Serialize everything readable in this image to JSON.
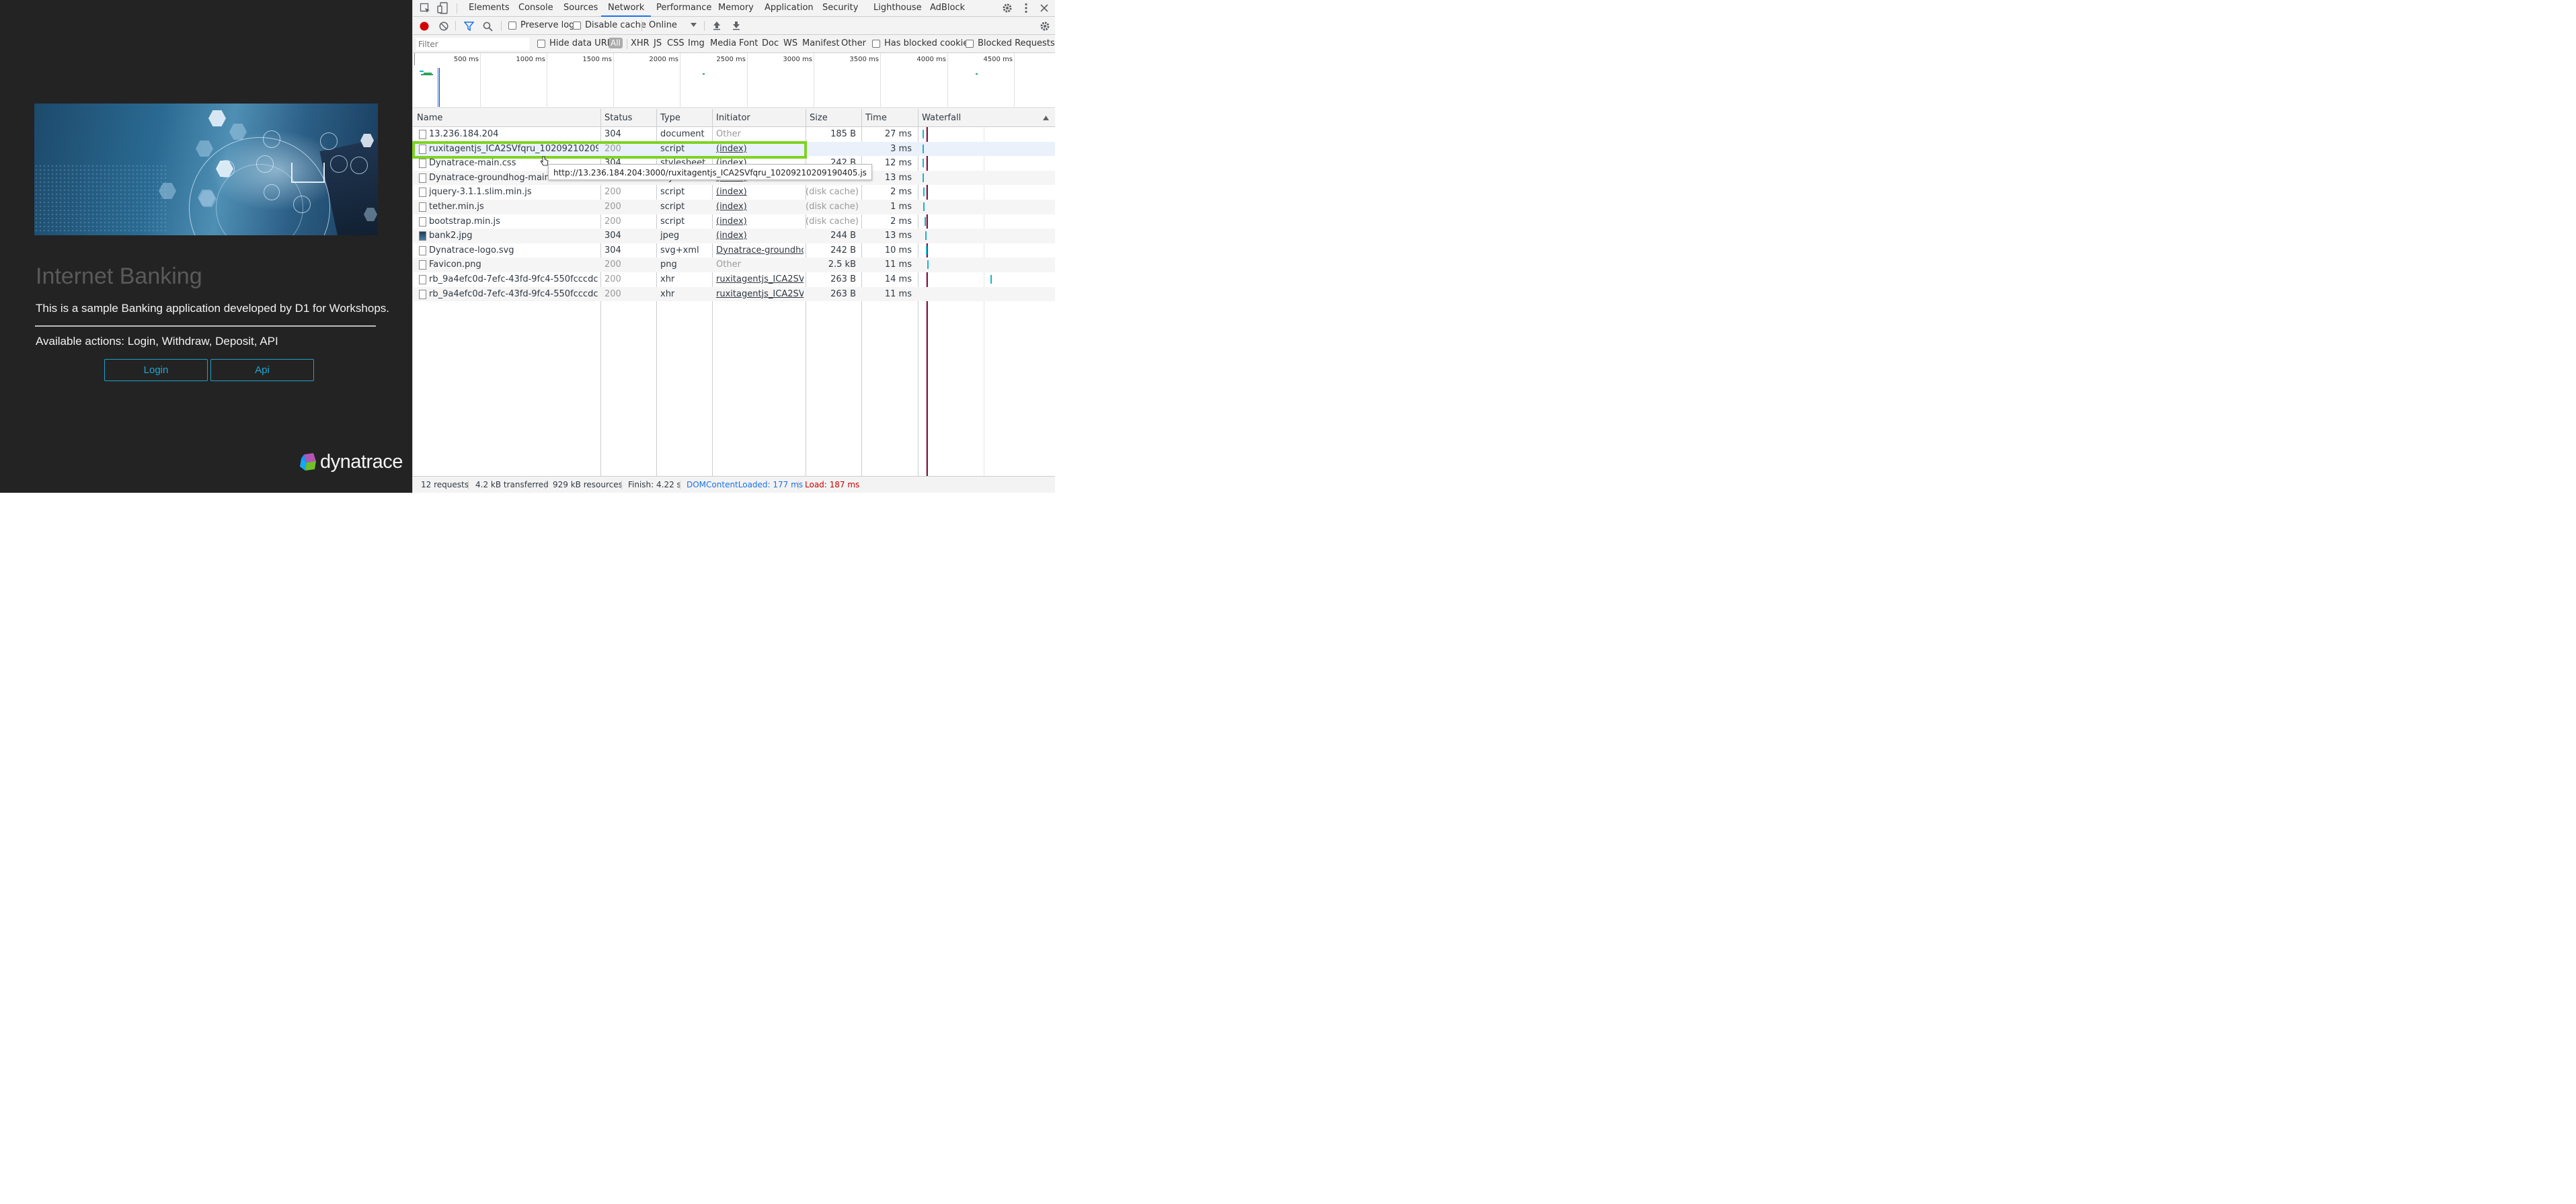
{
  "page": {
    "title": "Internet Banking",
    "description": "This is a sample Banking application developed by D1 for Workshops.",
    "actions": "Available actions: Login, Withdraw, Deposit, API",
    "buttons": {
      "login": "Login",
      "api": "Api"
    },
    "logo_text": "dynatrace"
  },
  "devtools": {
    "tabs": [
      "Elements",
      "Console",
      "Sources",
      "Network",
      "Performance",
      "Memory",
      "Application",
      "Security",
      "Lighthouse",
      "AdBlock"
    ],
    "selected_tab": "Network",
    "toolbar": {
      "preserve_log": "Preserve log",
      "disable_cache": "Disable cache",
      "throttle": "Online"
    },
    "filter": {
      "placeholder": "Filter",
      "hide_data_urls": "Hide data URLs",
      "types": [
        "All",
        "XHR",
        "JS",
        "CSS",
        "Img",
        "Media",
        "Font",
        "Doc",
        "WS",
        "Manifest",
        "Other"
      ],
      "has_blocked_cookies": "Has blocked cookies",
      "blocked_requests": "Blocked Requests"
    },
    "overview_ticks": [
      "500 ms",
      "1000 ms",
      "1500 ms",
      "2000 ms",
      "2500 ms",
      "3000 ms",
      "3500 ms",
      "4000 ms",
      "4500 ms"
    ],
    "columns": {
      "name": "Name",
      "status": "Status",
      "type": "Type",
      "initiator": "Initiator",
      "size": "Size",
      "time": "Time",
      "waterfall": "Waterfall"
    },
    "requests": [
      {
        "name": "13.236.184.204",
        "status": "304",
        "type": "document",
        "initiator": "Other",
        "size": "185 B",
        "time": "27 ms"
      },
      {
        "name": "ruxitagentjs_ICA2SVfqru_102092102091904...",
        "status": "200",
        "type": "script",
        "initiator": "(index)",
        "size": "",
        "time": "3 ms"
      },
      {
        "name": "Dynatrace-main.css",
        "status": "304",
        "type": "stylesheet",
        "initiator": "(index)",
        "size": "242 B",
        "time": "12 ms"
      },
      {
        "name": "Dynatrace-groundhog-main.css",
        "status": "304",
        "type": "stylesheet",
        "initiator": "(index)",
        "size": "244 B",
        "time": "13 ms"
      },
      {
        "name": "jquery-3.1.1.slim.min.js",
        "status": "200",
        "type": "script",
        "initiator": "(index)",
        "size": "(disk cache)",
        "time": "2 ms"
      },
      {
        "name": "tether.min.js",
        "status": "200",
        "type": "script",
        "initiator": "(index)",
        "size": "(disk cache)",
        "time": "1 ms"
      },
      {
        "name": "bootstrap.min.js",
        "status": "200",
        "type": "script",
        "initiator": "(index)",
        "size": "(disk cache)",
        "time": "2 ms"
      },
      {
        "name": "bank2.jpg",
        "status": "304",
        "type": "jpeg",
        "initiator": "(index)",
        "size": "244 B",
        "time": "13 ms"
      },
      {
        "name": "Dynatrace-logo.svg",
        "status": "304",
        "type": "svg+xml",
        "initiator": "Dynatrace-groundho...",
        "size": "242 B",
        "time": "10 ms"
      },
      {
        "name": "Favicon.png",
        "status": "200",
        "type": "png",
        "initiator": "Other",
        "size": "2.5 kB",
        "time": "11 ms"
      },
      {
        "name": "rb_9a4efc0d-7efc-43fd-9fc4-550fcccdcac7?t...",
        "status": "200",
        "type": "xhr",
        "initiator": "ruxitagentjs_ICA2SVfq...",
        "size": "263 B",
        "time": "14 ms"
      },
      {
        "name": "rb_9a4efc0d-7efc-43fd-9fc4-550fcccdcac7?t...",
        "status": "200",
        "type": "xhr",
        "initiator": "ruxitagentjs_ICA2SVfq...",
        "size": "263 B",
        "time": "11 ms"
      }
    ],
    "tooltip": "http://13.236.184.204:3000/ruxitagentjs_ICA2SVfqru_10209210209190405.js",
    "status_bar": {
      "requests": "12 requests",
      "transferred": "4.2 kB transferred",
      "resources": "929 kB resources",
      "finish": "Finish: 4.22 s",
      "dcl": "DOMContentLoaded: 177 ms",
      "load": "Load: 187 ms"
    },
    "colors": {
      "accent": "#1a73e8",
      "highlight": "#7ed321",
      "dcl": "#1a73e8",
      "load": "#c80000",
      "record": "#d30000"
    }
  }
}
